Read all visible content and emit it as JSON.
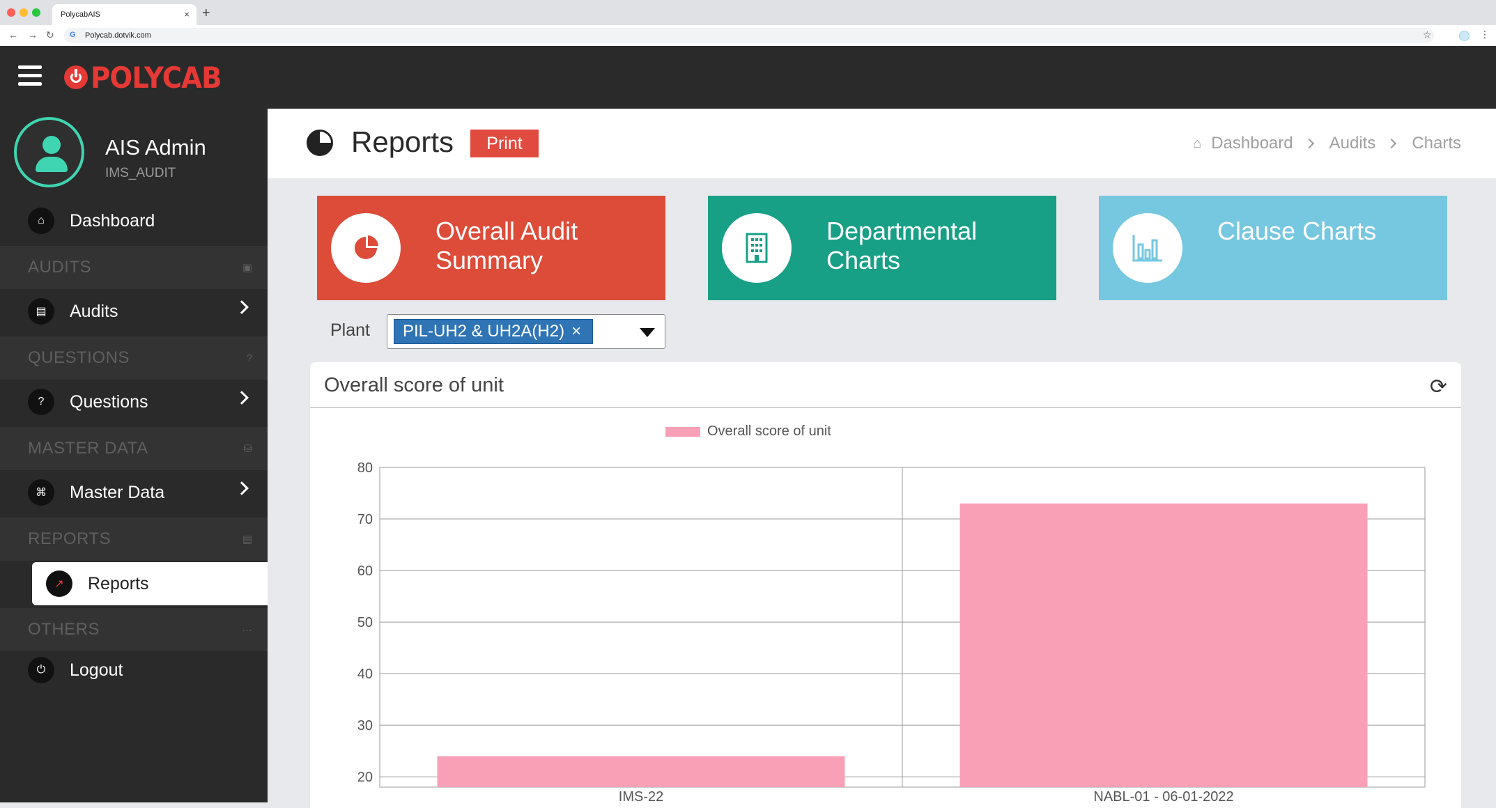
{
  "browser": {
    "tab_title": "PolycabAIS",
    "tab_close": "×",
    "new_tab": "+",
    "url": "Polycab.dotvik.com"
  },
  "header": {
    "brand": "POLYCAB"
  },
  "user": {
    "name": "AIS Admin",
    "role": "IMS_AUDIT"
  },
  "sidebar": {
    "dashboard": "Dashboard",
    "sections": {
      "audits": "AUDITS",
      "questions": "QUESTIONS",
      "master_data": "MASTER DATA",
      "reports": "REPORTS",
      "others": "OTHERS"
    },
    "items": {
      "audits": "Audits",
      "questions": "Questions",
      "master_data": "Master Data",
      "reports": "Reports",
      "logout": "Logout"
    },
    "questions_glyph": "?",
    "others_glyph": "···"
  },
  "page": {
    "title": "Reports",
    "print_label": "Print",
    "breadcrumb": [
      "Dashboard",
      "Audits",
      "Charts"
    ]
  },
  "tiles": [
    {
      "line1": "Overall Audit",
      "line2": "Summary",
      "color": "#dd4b39"
    },
    {
      "line1": "Departmental",
      "line2": "Charts",
      "color": "#17a085"
    },
    {
      "line1": "Clause Charts",
      "line2": "",
      "color": "#76c7e0"
    }
  ],
  "filter": {
    "label": "Plant",
    "selected": "PIL-UH2 & UH2A(H2)",
    "remove_glyph": "×"
  },
  "card": {
    "title": "Overall score of unit"
  },
  "colors": {
    "bar": "#f9a0b7",
    "accent": "#e53935",
    "sidebar_bg": "#2a2a2a"
  },
  "chart_data": {
    "type": "bar",
    "categories": [
      "IMS-22",
      "NABL-01 - 06-01-2022"
    ],
    "series": [
      {
        "name": "Overall score of unit",
        "values": [
          24,
          73
        ]
      }
    ],
    "ylim": [
      18,
      80
    ],
    "yticks": [
      20,
      30,
      40,
      50,
      60,
      70,
      80
    ],
    "legend": "top",
    "grid": true
  }
}
